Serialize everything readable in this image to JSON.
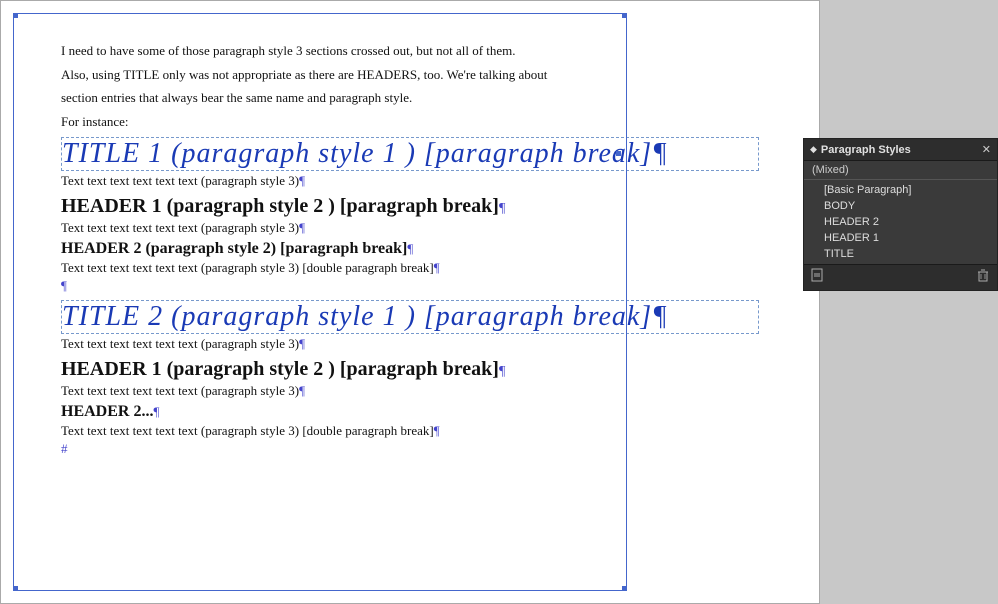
{
  "document": {
    "intro_line1": "I need to have some of those paragraph style 3 sections crossed out, but not all of them.",
    "intro_line2": "Also, using TITLE only was not appropriate as there are HEADERS, too. We're talking about",
    "intro_line3": "section entries that always bear the same name and paragraph style.",
    "intro_line4": "For instance:",
    "title1": "TITLE 1 (paragraph style 1 ) [paragraph break]",
    "title1_pilcrow": "¶",
    "body1": "Text text text text text text (paragraph style 3)",
    "body1_pilcrow": "¶",
    "header1_1": "HEADER 1 (paragraph style 2 ) [paragraph break]",
    "header1_1_pilcrow": "¶",
    "body2": "Text text text text text text (paragraph style 3)",
    "body2_pilcrow": "¶",
    "header2_1": "HEADER 2 (paragraph style 2) [paragraph break]",
    "header2_1_pilcrow": "¶",
    "body3": "Text text text text text text (paragraph style 3) [double paragraph break]",
    "body3_pilcrow": "¶",
    "spacer_pilcrow": "¶",
    "title2": "TITLE 2 (paragraph style 1 ) [paragraph break]",
    "title2_pilcrow": "¶",
    "body4": "Text text text text text text (paragraph style 3)",
    "body4_pilcrow": "¶",
    "header1_2": "HEADER 1 (paragraph style 2 ) [paragraph break]",
    "header1_2_pilcrow": "¶",
    "body5": "Text text text text text text (paragraph style 3)",
    "body5_pilcrow": "¶",
    "header2_2": "HEADER 2...",
    "header2_2_pilcrow": "¶",
    "body6": "Text text text text text text (paragraph style 3) [double paragraph break]",
    "body6_pilcrow": "¶",
    "hash": "#"
  },
  "panel": {
    "close_label": "✕",
    "diamond": "◆",
    "title": "Paragraph Styles",
    "mixed_label": "(Mixed)",
    "styles": [
      {
        "name": "[Basic Paragraph]"
      },
      {
        "name": "BODY"
      },
      {
        "name": "HEADER 2"
      },
      {
        "name": "HEADER 1"
      },
      {
        "name": "TITLE"
      }
    ],
    "footer_icon_left": "⊞",
    "footer_icon_right": "⊟"
  }
}
